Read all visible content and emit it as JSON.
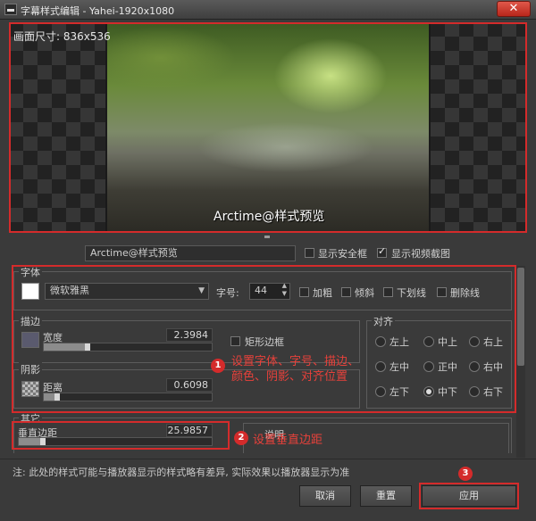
{
  "window": {
    "title": "字幕样式编辑 - Yahei-1920x1080",
    "close_glyph": "✕"
  },
  "preview": {
    "canvas_size": "画面尺寸: 836x536",
    "subtitle": "Arctime@样式预览"
  },
  "toolbar": {
    "preview_text": "Arctime@样式预览",
    "safe_frame_label": "显示安全框",
    "safe_frame_checked": false,
    "video_frame_label": "显示视频截图",
    "video_frame_checked": true
  },
  "font": {
    "group_label": "字体",
    "color": "#ffffff",
    "family": "微软雅黑",
    "size_label": "字号:",
    "size_value": "44",
    "bold_label": "加粗",
    "italic_label": "倾斜",
    "underline_label": "下划线",
    "strike_label": "删除线"
  },
  "stroke": {
    "group_label": "描边",
    "width_label": "宽度",
    "width_value": "2.3984",
    "rect_border_label": "矩形边框"
  },
  "shadow": {
    "group_label": "阴影",
    "distance_label": "距离",
    "distance_value": "0.6098"
  },
  "other": {
    "group_label": "其它",
    "vmargin_label": "垂直边距",
    "vmargin_value": "25.9857",
    "note_label": "说明"
  },
  "align": {
    "group_label": "对齐",
    "options": [
      "左上",
      "中上",
      "右上",
      "左中",
      "正中",
      "右中",
      "左下",
      "中下",
      "右下"
    ],
    "selected": "中下"
  },
  "annotations": {
    "badge1": "1",
    "note1": "设置字体、字号、描边、颜色、阴影、对齐位置",
    "badge2": "2",
    "note2": "设置垂直边距",
    "badge3": "3"
  },
  "footer": {
    "note": "注: 此处的样式可能与播放器显示的样式略有差异, 实际效果以播放器显示为准",
    "cancel_label": "取消",
    "reset_label": "重置",
    "apply_label": "应用"
  },
  "colors": {
    "annotation_red": "#d42b2b"
  }
}
